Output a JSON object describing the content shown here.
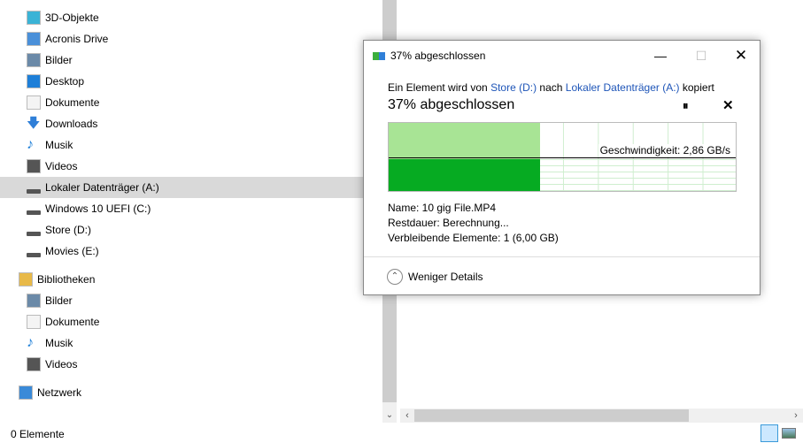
{
  "nav": {
    "items": [
      {
        "label": "3D-Objekte",
        "icon": "3d-objects-icon",
        "color": "#3bb3d6"
      },
      {
        "label": "Acronis Drive",
        "icon": "cloud-drive-icon",
        "color": "#4a90d9"
      },
      {
        "label": "Bilder",
        "icon": "pictures-icon",
        "color": "#6b8aa8"
      },
      {
        "label": "Desktop",
        "icon": "desktop-icon",
        "color": "#1e7fd8"
      },
      {
        "label": "Dokumente",
        "icon": "documents-icon",
        "color": "#888888"
      },
      {
        "label": "Downloads",
        "icon": "downloads-icon",
        "color": "#2f7fd8"
      },
      {
        "label": "Musik",
        "icon": "music-icon",
        "color": "#1e7fd8"
      },
      {
        "label": "Videos",
        "icon": "videos-icon",
        "color": "#555555"
      },
      {
        "label": "Lokaler Datenträger (A:)",
        "icon": "drive-icon",
        "color": "#666666"
      },
      {
        "label": "Windows 10 UEFI (C:)",
        "icon": "windows-drive-icon",
        "color": "#666666"
      },
      {
        "label": "Store (D:)",
        "icon": "drive-icon",
        "color": "#666666"
      },
      {
        "label": "Movies (E:)",
        "icon": "drive-icon",
        "color": "#666666"
      },
      {
        "label": "Bibliotheken",
        "icon": "libraries-icon",
        "color": "#e8b948"
      },
      {
        "label": "Bilder",
        "icon": "pictures-icon",
        "color": "#6b8aa8"
      },
      {
        "label": "Dokumente",
        "icon": "documents-icon",
        "color": "#888888"
      },
      {
        "label": "Musik",
        "icon": "music-icon",
        "color": "#1e7fd8"
      },
      {
        "label": "Videos",
        "icon": "videos-icon",
        "color": "#555555"
      },
      {
        "label": "Netzwerk",
        "icon": "network-icon",
        "color": "#3a8ad8"
      }
    ]
  },
  "status": {
    "count": "0 Elemente"
  },
  "dialog": {
    "title": "37% abgeschlossen",
    "line_prefix": "Ein Element wird von",
    "source": "Store (D:)",
    "line_mid": "nach",
    "dest": "Lokaler Datenträger (A:)",
    "line_suffix": "kopiert",
    "progress_text": "37% abgeschlossen",
    "progress_percent": 37,
    "speed": "Geschwindigkeit: 2,86 GB/s",
    "name": "Name:  10 gig File.MP4",
    "remaining": "Restdauer:  Berechnung...",
    "items_left": "Verbleibende Elemente:  1 (6,00 GB)",
    "less_details": "Weniger Details",
    "pause_icon": "⏸",
    "cancel_icon": "✕"
  }
}
